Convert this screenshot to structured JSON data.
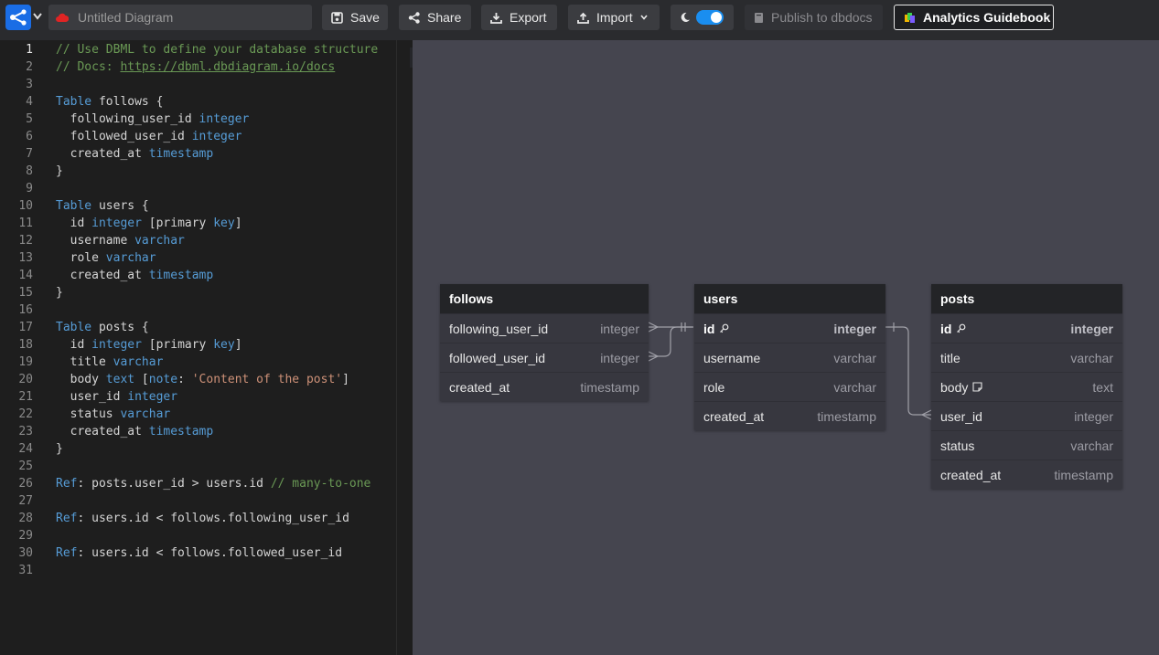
{
  "app": {
    "title_placeholder": "Untitled Diagram",
    "toolbar": {
      "save": "Save",
      "share": "Share",
      "export": "Export",
      "import": "Import",
      "publish": "Publish to dbdocs",
      "guidebook": "Analytics Guidebook"
    },
    "dark_mode_on": true
  },
  "editor": {
    "line_numbers": [
      "1",
      "2",
      "3",
      "4",
      "5",
      "6",
      "7",
      "8",
      "9",
      "10",
      "11",
      "12",
      "13",
      "14",
      "15",
      "16",
      "17",
      "18",
      "19",
      "20",
      "21",
      "22",
      "23",
      "24",
      "25",
      "26",
      "27",
      "28",
      "29",
      "30",
      "31"
    ],
    "code": {
      "l1": "// Use DBML to define your database structure",
      "l2_prefix": "// Docs: ",
      "l2_link": "https://dbml.dbdiagram.io/docs",
      "kw_table": "Table",
      "follows_open": " follows {",
      "following_user_id": "  following_user_id ",
      "followed_user_id": "  followed_user_id ",
      "created_at": "  created_at ",
      "close": "}",
      "users_open": " users {",
      "id": "  id ",
      "pk_open": " [",
      "primary": "primary ",
      "key": "key",
      "pk_close": "]",
      "username": "  username ",
      "role": "  role ",
      "posts_open": " posts {",
      "title": "  title ",
      "body": "  body ",
      "note_open": " [",
      "note": "note",
      "note_colon": ": ",
      "note_str": "'Content of the post'",
      "note_close": "]",
      "user_id": "  user_id ",
      "status": "  status ",
      "t_integer": "integer",
      "t_timestamp": "timestamp",
      "t_varchar": "varchar",
      "t_text": "text",
      "ref_kw": "Ref",
      "ref1": ": posts.user_id > users.id ",
      "ref1_comment": "// many-to-one",
      "ref2": ": users.id < follows.following_user_id",
      "ref3": ": users.id < follows.followed_user_id"
    }
  },
  "diagram": {
    "tables": {
      "follows": {
        "name": "follows",
        "fields": [
          {
            "name": "following_user_id",
            "type": "integer"
          },
          {
            "name": "followed_user_id",
            "type": "integer"
          },
          {
            "name": "created_at",
            "type": "timestamp"
          }
        ]
      },
      "users": {
        "name": "users",
        "fields": [
          {
            "name": "id",
            "type": "integer"
          },
          {
            "name": "username",
            "type": "varchar"
          },
          {
            "name": "role",
            "type": "varchar"
          },
          {
            "name": "created_at",
            "type": "timestamp"
          }
        ]
      },
      "posts": {
        "name": "posts",
        "fields": [
          {
            "name": "id",
            "type": "integer"
          },
          {
            "name": "title",
            "type": "varchar"
          },
          {
            "name": "body",
            "type": "text"
          },
          {
            "name": "user_id",
            "type": "integer"
          },
          {
            "name": "status",
            "type": "varchar"
          },
          {
            "name": "created_at",
            "type": "timestamp"
          }
        ]
      }
    }
  }
}
